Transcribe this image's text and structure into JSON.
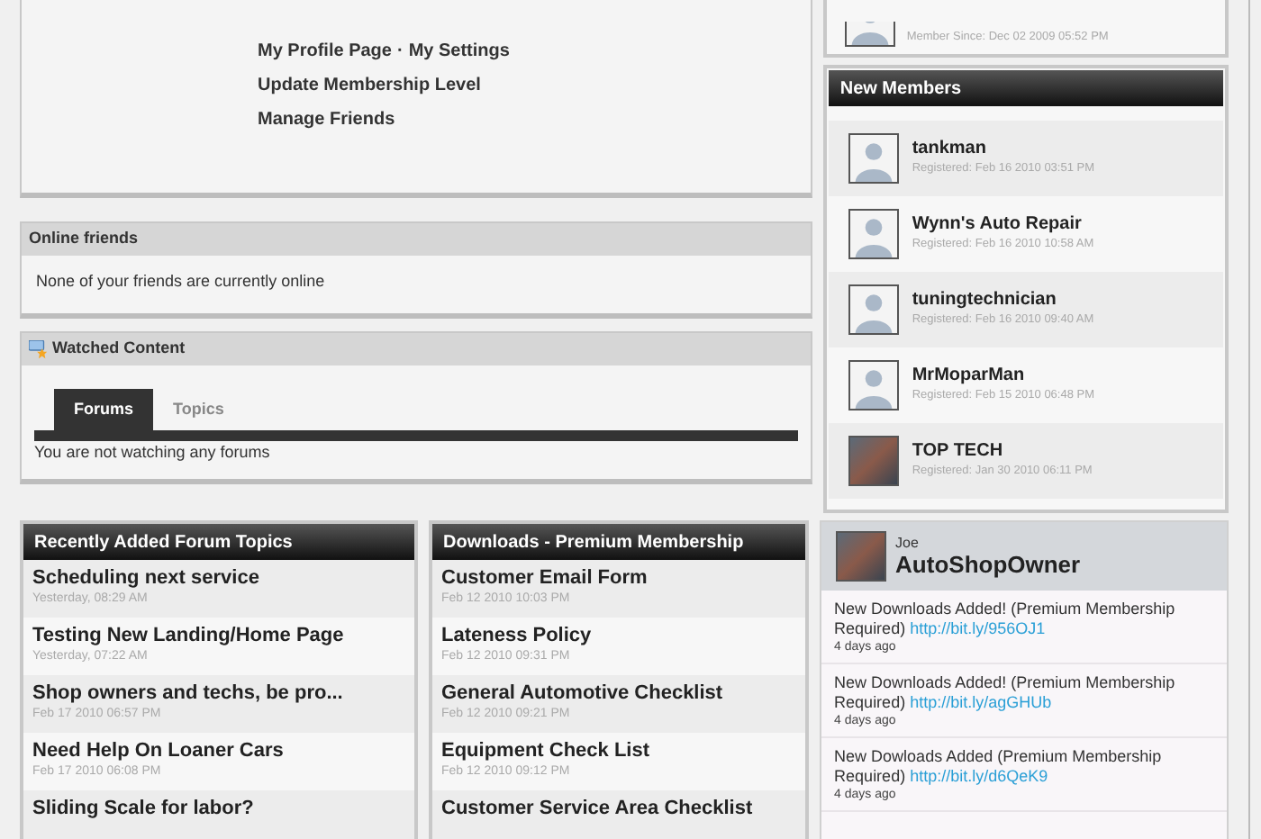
{
  "profile_links": [
    {
      "label": "My Profile Page"
    },
    {
      "label": "My Settings"
    }
  ],
  "profile_separator": "·",
  "profile_actions": [
    "Update Membership Level",
    "Manage Friends"
  ],
  "member_since": "Member Since: Dec 02 2009 05:52 PM",
  "online_friends": {
    "title": "Online friends",
    "message": "None of your friends are currently online"
  },
  "watched_content": {
    "title": "Watched Content",
    "tabs": [
      {
        "label": "Forums",
        "selected": true
      },
      {
        "label": "Topics",
        "selected": false
      }
    ],
    "message": "You are not watching any forums"
  },
  "new_members": {
    "title": "New Members",
    "items": [
      {
        "name": "tankman",
        "registered": "Registered: Feb 16 2010 03:51 PM",
        "photo": false
      },
      {
        "name": "Wynn's Auto Repair",
        "registered": "Registered: Feb 16 2010 10:58 AM",
        "photo": false
      },
      {
        "name": "tuningtechnician",
        "registered": "Registered: Feb 16 2010 09:40 AM",
        "photo": false
      },
      {
        "name": "MrMoparMan",
        "registered": "Registered: Feb 15 2010 06:48 PM",
        "photo": false
      },
      {
        "name": "TOP TECH",
        "registered": "Registered: Jan 30 2010 06:11 PM",
        "photo": true
      }
    ]
  },
  "forum_topics": {
    "title": "Recently Added Forum Topics",
    "items": [
      {
        "title": "Scheduling next service",
        "date": "Yesterday, 08:29 AM"
      },
      {
        "title": "Testing New Landing/Home Page",
        "date": "Yesterday, 07:22 AM"
      },
      {
        "title": "Shop owners and techs, be pro...",
        "date": "Feb 17 2010 06:57 PM"
      },
      {
        "title": "Need Help On Loaner Cars",
        "date": "Feb 17 2010 06:08 PM"
      },
      {
        "title": "Sliding Scale for labor?"
      }
    ]
  },
  "downloads": {
    "title": "Downloads - Premium Membership",
    "items": [
      {
        "title": "Customer Email Form",
        "date": "Feb 12 2010 10:03 PM"
      },
      {
        "title": "Lateness Policy",
        "date": "Feb 12 2010 09:31 PM"
      },
      {
        "title": "General Automotive Checklist",
        "date": "Feb 12 2010 09:21 PM"
      },
      {
        "title": "Equipment Check List",
        "date": "Feb 12 2010 09:12 PM"
      },
      {
        "title": "Customer Service Area Checklist"
      }
    ]
  },
  "twitter": {
    "real_name": "Joe",
    "handle": "AutoShopOwner",
    "tweets": [
      {
        "text": "New Downloads Added! (Premium Membership Required)",
        "link": "http://bit.ly/956OJ1",
        "time": "4 days ago"
      },
      {
        "text": "New Downloads Added! (Premium Membership Required)",
        "link": "http://bit.ly/agGHUb",
        "time": "4 days ago"
      },
      {
        "text": "New Dowloads Added (Premium Membership Required)",
        "link": "http://bit.ly/d6QeK9",
        "time": "4 days ago"
      }
    ]
  }
}
